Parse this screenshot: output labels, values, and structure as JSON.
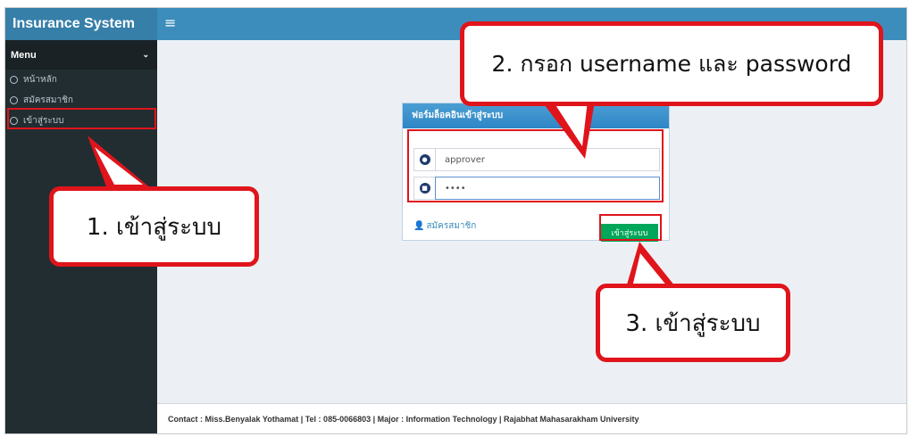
{
  "header": {
    "app_title": "Insurance System",
    "menu_toggle_icon": "hamburger-icon"
  },
  "sidebar": {
    "menu_label": "Menu",
    "items": [
      {
        "label": "หน้าหลัก"
      },
      {
        "label": "สมัครสมาชิก"
      },
      {
        "label": "เข้าสู่ระบบ"
      }
    ]
  },
  "login_form": {
    "title": "ฟอร์มล็อคอินเข้าสู่ระบบ",
    "username_value": "approver",
    "password_value": "••••",
    "register_link": "สมัครสมาชิก",
    "login_button": "เข้าสู่ระบบ"
  },
  "footer": {
    "text": "Contact : Miss.Benyalak Yothamat | Tel : 085-0066803 | Major : Information Technology | Rajabhat Mahasarakham University"
  },
  "annotations": {
    "step1": "1. เข้าสู่ระบบ",
    "step2": "2. กรอก username และ password",
    "step3": "3. เข้าสู่ระบบ"
  },
  "colors": {
    "header_bg": "#3c8dbc",
    "logo_bg": "#367fa9",
    "sidebar_bg": "#222d32",
    "button_green": "#00a65a",
    "annotation_red": "#e0141b"
  }
}
